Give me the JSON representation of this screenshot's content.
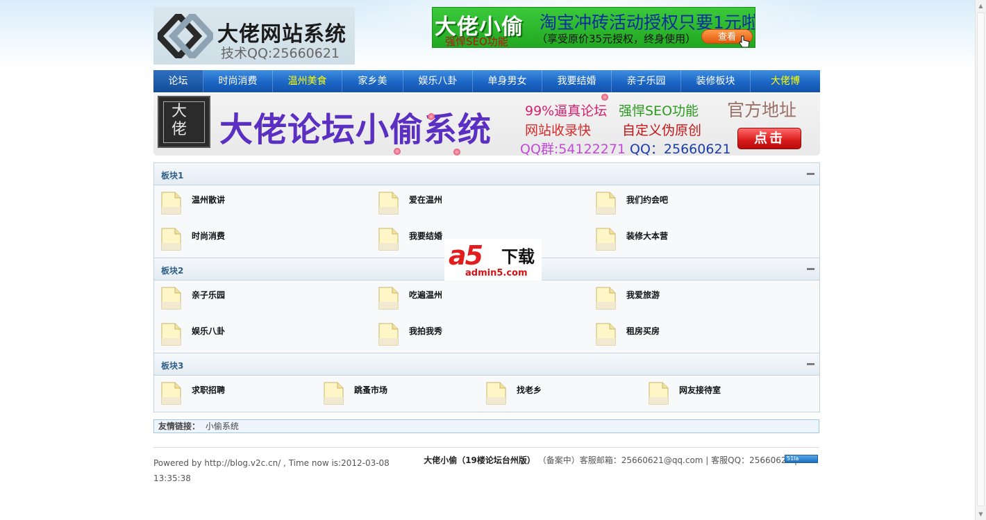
{
  "header": {
    "logo_title": "大佬网站系统",
    "logo_sub": "技术QQ:25660621"
  },
  "top_ad": {
    "brand": "大佬小偷",
    "seo": "强悍SEO功能",
    "headline": "淘宝冲砖活动授权只要1元啦",
    "subline": "（享受原价35元授权，终身使用）",
    "button": "查看"
  },
  "nav": {
    "items": [
      {
        "label": "论坛",
        "active": true,
        "highlight": false,
        "width": 72
      },
      {
        "label": "时尚消费",
        "active": false,
        "highlight": false,
        "width": 100
      },
      {
        "label": "温州美食",
        "active": false,
        "highlight": true,
        "width": 100
      },
      {
        "label": "家乡美",
        "active": false,
        "highlight": false,
        "width": 88
      },
      {
        "label": "娱乐八卦",
        "active": false,
        "highlight": false,
        "width": 100
      },
      {
        "label": "单身男女",
        "active": false,
        "highlight": false,
        "width": 100
      },
      {
        "label": "我要结婚",
        "active": false,
        "highlight": false,
        "width": 100
      },
      {
        "label": "亲子乐园",
        "active": false,
        "highlight": false,
        "width": 100
      },
      {
        "label": "装修板块",
        "active": false,
        "highlight": false,
        "width": 100
      },
      {
        "label": "大佬博",
        "active": false,
        "highlight": true,
        "width": 100
      }
    ]
  },
  "banner": {
    "seal": "大佬",
    "title": "大佬论坛小偷系统",
    "feature1": "99%逼真论坛",
    "feature2": "强悍SEO功能",
    "feature3": "网站收录快",
    "feature4": "自定义伪原创",
    "qq_group": "QQ群:54122271",
    "qq": "QQ：25660621",
    "official": "官方地址",
    "click": "点击"
  },
  "sections": [
    {
      "title": "板块1",
      "forums": [
        "温州散讲",
        "爱在温州",
        "我们约会吧",
        "时尚消费",
        "我要结婚",
        "装修大本营"
      ]
    },
    {
      "title": "板块2",
      "forums": [
        "亲子乐园",
        "吃遍温州",
        "我爱旅游",
        "娱乐八卦",
        "我拍我秀",
        "租房买房"
      ]
    },
    {
      "title": "板块3",
      "forums": [
        "求职招聘",
        "跳蚤市场",
        "找老乡",
        "网友接待室"
      ]
    }
  ],
  "watermark": {
    "a5": "a5",
    "dl": "下载",
    "site": "admin5.com"
  },
  "links": {
    "label": "友情链接：",
    "items": [
      "小偷系统"
    ]
  },
  "footer": {
    "powered": "Powered by http://blog.v2c.cn/ , Time now is:2012-03-08 13:35:38",
    "brand": "大佬小偷（19楼论坛台州版）",
    "contact": "（备案中）客服邮箱：25660621@qq.com | 客服QQ：25660621 |",
    "badge": "51la"
  }
}
